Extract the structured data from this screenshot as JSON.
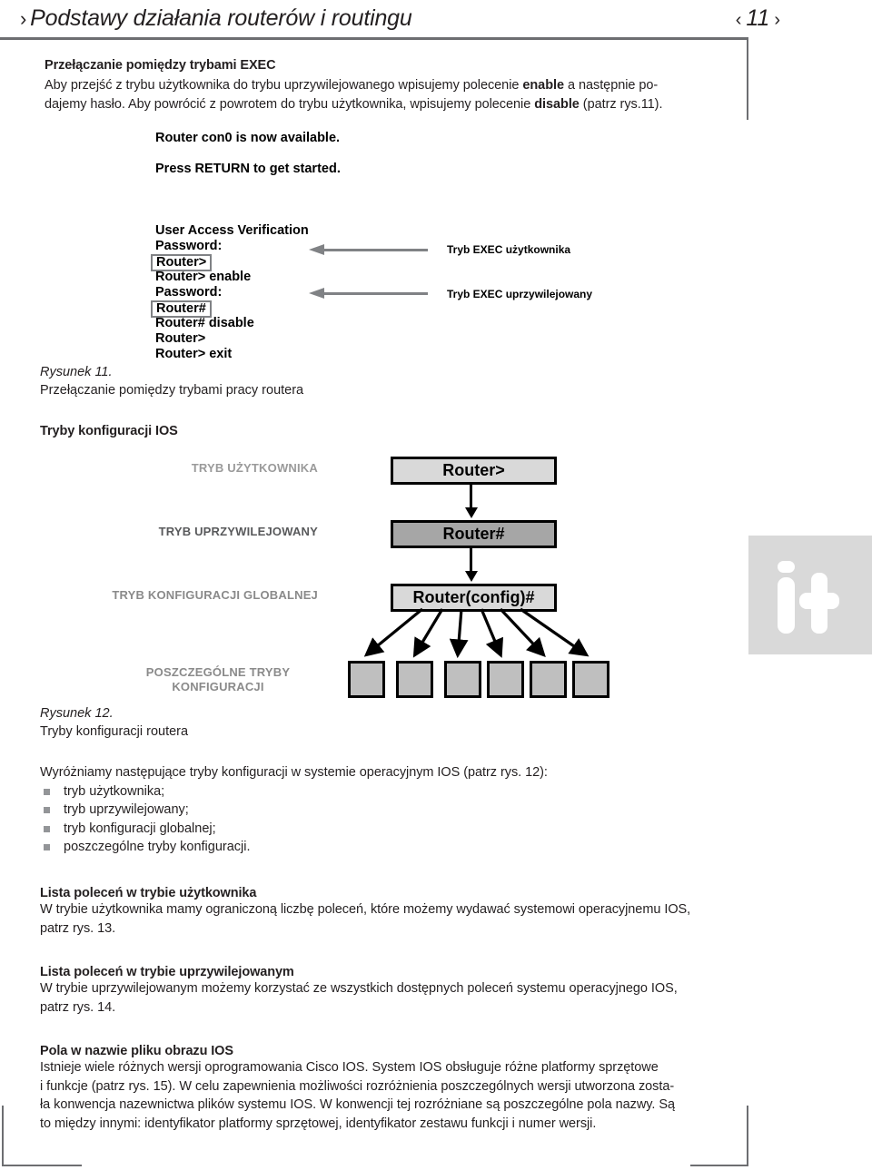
{
  "running_head": {
    "chevron": "›",
    "title": "Podstawy działania routerów i routingu",
    "page_left_chevron": "‹",
    "page_number": "11",
    "page_right_chevron": "›"
  },
  "sections": {
    "exec_switching": {
      "heading": "Przełączanie pomiędzy trybami EXEC",
      "body_1": "Aby przejść z trybu użytkownika do trybu uprzywilejowanego wpisujemy polecenie ",
      "bold_1": "enable",
      "body_2": " a następnie po-",
      "body_3": "dajemy hasło. Aby powrócić z powrotem do trybu użytkownika, wpisujemy polecenie ",
      "bold_2": "disable",
      "body_4": " (patrz rys.11)."
    },
    "ios_modes_heading": "Tryby konfiguracji IOS",
    "list_intro": "Wyróżniamy następujące tryby konfiguracji w systemie operacyjnym IOS (patrz rys. 12):",
    "mode_list": [
      "tryb użytkownika;",
      "tryb uprzywilejowany;",
      "tryb konfiguracji globalnej;",
      "poszczególne tryby konfiguracji."
    ],
    "user_cmds": {
      "heading": "Lista poleceń w trybie użytkownika",
      "line1": "W trybie użytkownika mamy ograniczoną liczbę poleceń, które możemy wydawać systemowi operacyjnemu IOS,",
      "line2": "patrz rys. 13."
    },
    "priv_cmds": {
      "heading": "Lista poleceń w trybie uprzywilejowanym",
      "line1": "W trybie uprzywilejowanym możemy korzystać ze wszystkich dostępnych poleceń systemu operacyjnego IOS,",
      "line2": "patrz rys. 14."
    },
    "image_fields": {
      "heading": "Pola w nazwie pliku obrazu IOS",
      "line1": "Istnieje wiele różnych wersji oprogramowania Cisco IOS. System IOS obsługuje różne platformy sprzętowe",
      "line2": "i funkcje (patrz rys. 15). W celu zapewnienia możliwości rozróżnienia poszczególnych wersji utworzona zosta-",
      "line3": "ła konwencja nazewnictwa plików systemu IOS. W konwencji tej rozróżniane są poszczególne pola nazwy. Są",
      "line4": "to między innymi: identyfikator platformy sprzętowej, identyfikator zestawu funkcji i numer wersji."
    }
  },
  "figure_11": {
    "terminal_lines": [
      "Router con0 is now available.",
      "",
      "Press RETURN to get started.",
      "",
      "",
      "User Access Verification",
      "Password:",
      "Router>",
      "Router> enable",
      "Password:",
      "Router#",
      "Router# disable",
      "Router>",
      "Router> exit"
    ],
    "boxed_prompt_1": "Router>",
    "boxed_prompt_2": "Router#",
    "annotation_1": "Tryb EXEC użytkownika",
    "annotation_2": "Tryb EXEC uprzywilejowany",
    "caption_number": "Rysunek 11.",
    "caption_text": "Przełączanie pomiędzy trybami pracy routera"
  },
  "figure_12": {
    "rows": [
      {
        "label": "TRYB UŻYTKOWNIKA",
        "node": "Router>"
      },
      {
        "label": "TRYB UPRZYWILEJOWANY",
        "node": "Router#"
      },
      {
        "label": "TRYB KONFIGURACJI GLOBALNEJ",
        "node": "Router(config)#"
      }
    ],
    "leaf_label_line1": "POSZCZEGÓLNE TRYBY",
    "leaf_label_line2": "KONFIGURACJI",
    "leaf_count": 6,
    "caption_number": "Rysunek 12.",
    "caption_text": "Tryby konfiguracji routera"
  },
  "logo": {
    "text": "i+"
  },
  "colors": {
    "text": "#231f20",
    "rule": "#6d6e71",
    "node_light": "#d9d9d9",
    "node_mid": "#a6a6a6",
    "leaf": "#bfbfbf",
    "bullet": "#939598",
    "label_light": "#9a9a9a",
    "label_dark": "#58595b",
    "logo_bg": "#d9d9d9"
  }
}
